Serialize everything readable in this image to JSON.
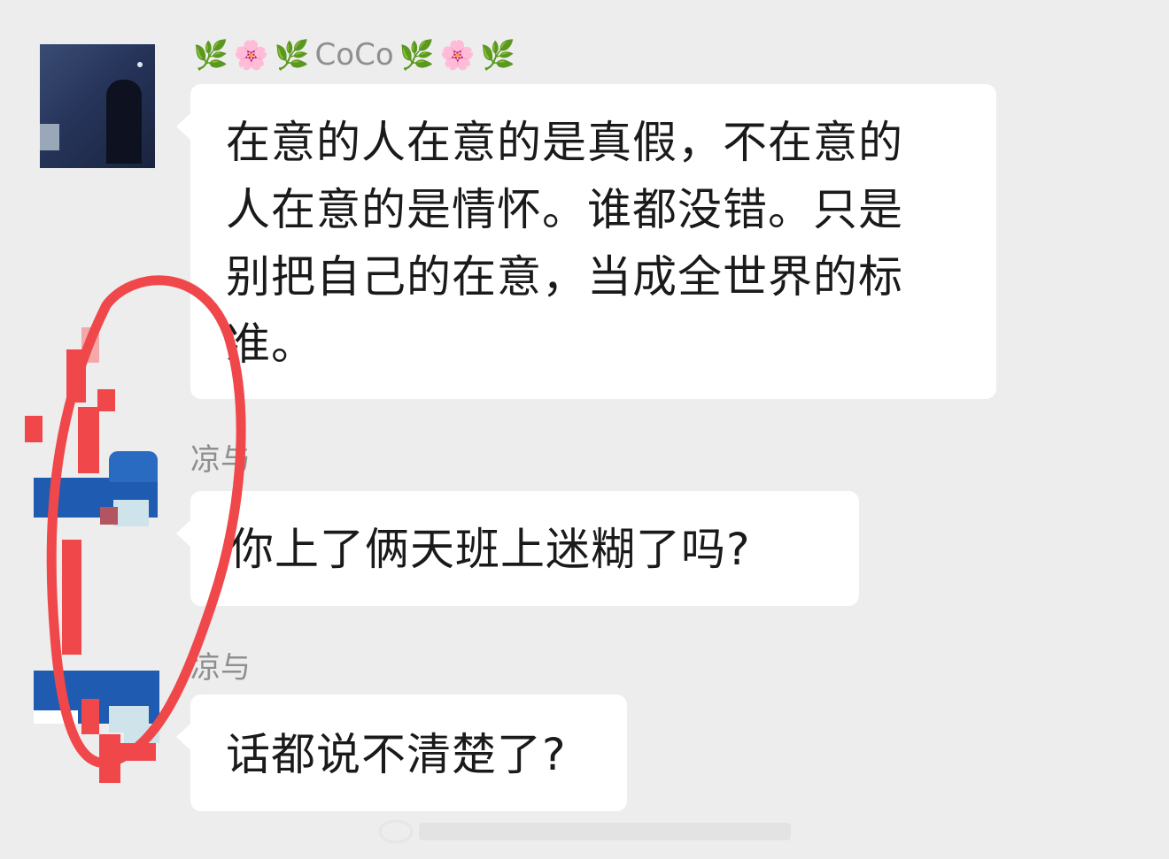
{
  "chat": {
    "messages": [
      {
        "sender": "CoCo",
        "sender_decorations": [
          "🌿",
          "🌸",
          "🌿"
        ],
        "sender_decorations_right": [
          "🌿",
          "🌸",
          "🌿"
        ],
        "lines": [
          "在意的人在意的是真假，不在意的",
          "人在意的是情怀。谁都没错。只是",
          "别把自己的在意，当成全世界的标",
          "准。"
        ]
      },
      {
        "sender": "凉与",
        "lines": [
          "你上了俩天班上迷糊了吗?"
        ]
      },
      {
        "sender": "凉与",
        "lines": [
          "话都说不清楚了?"
        ]
      }
    ]
  },
  "colors": {
    "background": "#ededed",
    "bubble": "#ffffff",
    "annotation_circle": "#f0484a",
    "sender_name": "#8f8f8f"
  },
  "icons": {
    "leaf": "leaf-emoji",
    "flower": "cherry-blossom-emoji"
  }
}
